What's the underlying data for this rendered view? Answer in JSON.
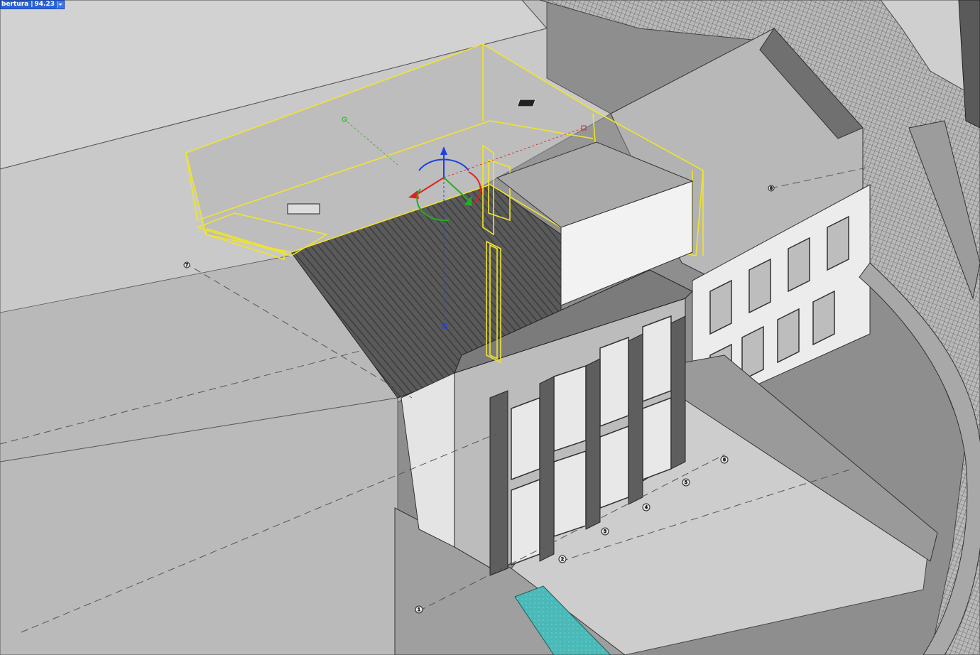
{
  "scene_tag": {
    "label": "bertura",
    "separator": "|",
    "value": "94.23",
    "dropdown_icon": "chevron-down-icon"
  },
  "colors": {
    "selection": "#f0e52a",
    "axis_x": "#e02020",
    "axis_y": "#22b022",
    "axis_z": "#2040e0",
    "pool_water": "#4ab9b8",
    "background": "#8e8e8e"
  },
  "grid_bubbles": [
    "1",
    "2",
    "3",
    "4",
    "5",
    "6",
    "7",
    "8"
  ]
}
